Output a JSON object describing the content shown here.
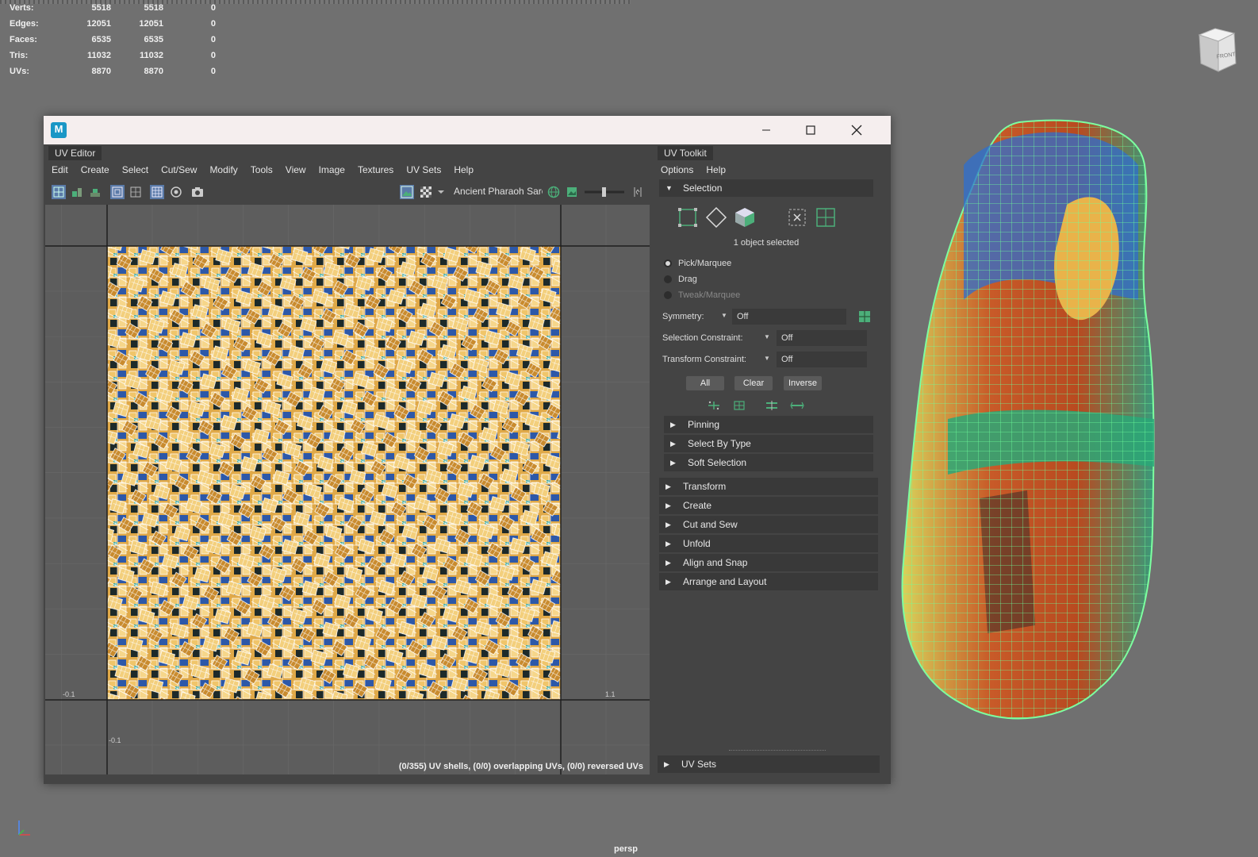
{
  "hud": {
    "rows": [
      {
        "label": "Verts:",
        "v1": "5518",
        "v2": "5518",
        "v3": "0"
      },
      {
        "label": "Edges:",
        "v1": "12051",
        "v2": "12051",
        "v3": "0"
      },
      {
        "label": "Faces:",
        "v1": "6535",
        "v2": "6535",
        "v3": "0"
      },
      {
        "label": "Tris:",
        "v1": "11032",
        "v2": "11032",
        "v3": "0"
      },
      {
        "label": "UVs:",
        "v1": "8870",
        "v2": "8870",
        "v3": "0"
      }
    ]
  },
  "viewport": {
    "camera_label": "persp",
    "viewcube_face": "FRONT"
  },
  "window": {
    "app_icon": "M",
    "minimize_icon": "minimize-icon",
    "maximize_icon": "maximize-icon",
    "close_icon": "close-icon"
  },
  "uv_editor": {
    "tab": "UV Editor",
    "menu": [
      "Edit",
      "Create",
      "Select",
      "Cut/Sew",
      "Modify",
      "Tools",
      "View",
      "Image",
      "Textures",
      "UV Sets",
      "Help"
    ],
    "texture_name": "Ancient Pharaoh Sarc",
    "grid_labels": {
      "neg_u": "-0.1",
      "pos_u": "1.1",
      "neg_v": "-0.1"
    },
    "status": "(0/355) UV shells, (0/0) overlapping UVs, (0/0) reversed UVs"
  },
  "toolkit": {
    "tab": "UV Toolkit",
    "menu": [
      "Options",
      "Help"
    ],
    "selection": {
      "header": "Selection",
      "summary": "1 object selected",
      "modes": [
        "Pick/Marquee",
        "Drag",
        "Tweak/Marquee"
      ],
      "symmetry": {
        "label": "Symmetry:",
        "value": "Off"
      },
      "selection_constraint": {
        "label": "Selection Constraint:",
        "value": "Off"
      },
      "transform_constraint": {
        "label": "Transform Constraint:",
        "value": "Off"
      },
      "buttons": {
        "all": "All",
        "clear": "Clear",
        "inverse": "Inverse"
      },
      "subsections": [
        "Pinning",
        "Select By Type",
        "Soft Selection"
      ]
    },
    "sections": [
      "Transform",
      "Create",
      "Cut and Sew",
      "Unfold",
      "Align and Snap",
      "Arrange and Layout"
    ],
    "footer_section": "UV Sets"
  },
  "colors": {
    "accent_green": "#2fd07a",
    "panel_bg": "#444444",
    "viewport_bg": "#707070"
  }
}
